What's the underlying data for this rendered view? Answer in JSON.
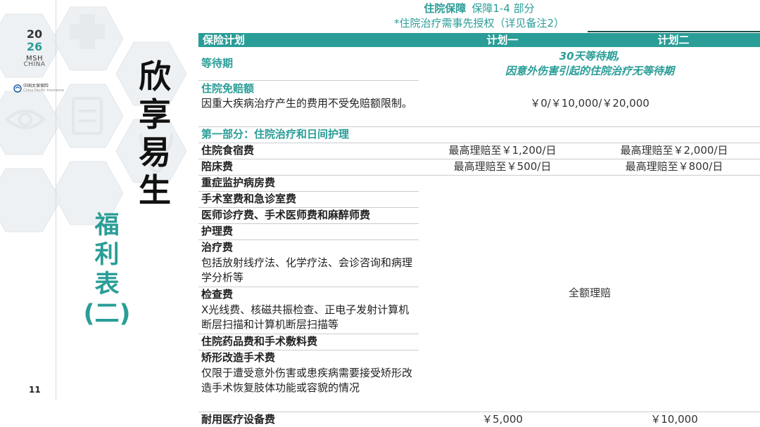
{
  "sidebar": {
    "logo_year_top": "20",
    "logo_year_bottom": "26",
    "logo_msh": "MSH",
    "logo_china": "CHINA",
    "partner_name": "中国太保保险",
    "partner_sub": "China Pacific Insurance",
    "title_main": [
      "欣",
      "享",
      "易",
      "生"
    ],
    "title_sub": [
      "福",
      "利",
      "表",
      "(二)"
    ],
    "page_number": "11"
  },
  "header": {
    "title_strong": "住院保障",
    "title_rest": "保障1-4 部分",
    "note": "*住院治疗需事先授权（详见备注2）"
  },
  "table": {
    "col_plan": "保险计划",
    "col_plan1": "计划一",
    "col_plan2": "计划二",
    "waiting_label": "等待期",
    "waiting_line1": "30天等待期,",
    "waiting_line2": "因意外伤害引起的住院治疗无等待期",
    "deductible_label": "住院免赔额",
    "deductible_desc": "因重大疾病治疗产生的费用不受免赔额限制。",
    "deductible_value": "￥0/￥10,000/￥20,000",
    "section1": "第一部分：住院治疗和日间护理",
    "room_board": "住院食宿费",
    "room_board_p1": "最高理赔至￥1,200/日",
    "room_board_p2": "最高理赔至￥2,000/日",
    "companion": "陪床费",
    "companion_p1": "最高理赔至￥500/日",
    "companion_p2": "最高理赔至￥800/日",
    "icu": "重症监护病房费",
    "surgery_room": "手术室费和急诊室费",
    "physician": "医师诊疗费、手术医师费和麻醉师费",
    "nursing": "护理费",
    "treatment": "治疗费",
    "treatment_desc": "包括放射线疗法、化学疗法、会诊咨询和病理学分析等",
    "examination": "检查费",
    "examination_desc": "X光线费、核磁共振检查、正电子发射计算机断层扫描和计算机断层扫描等",
    "drugs": "住院药品费和手术敷料费",
    "reconstructive": "矫形改造手术费",
    "reconstructive_desc": "仅限于遭受意外伤害或患疾病需要接受矫形改造手术恢复肢体功能或容貌的情况",
    "full_coverage": "全额理赔",
    "equipment": "耐用医疗设备费",
    "equipment_p1": "￥5,000",
    "equipment_p2": "￥10,000"
  },
  "colors": {
    "accent": "#2a9d97",
    "text": "#222222"
  },
  "icons": [
    "hexagon-pattern-background",
    "medical-cross-icon",
    "clipboard-icon",
    "stethoscope-icon",
    "eye-icon",
    "partner-logo-icon"
  ]
}
